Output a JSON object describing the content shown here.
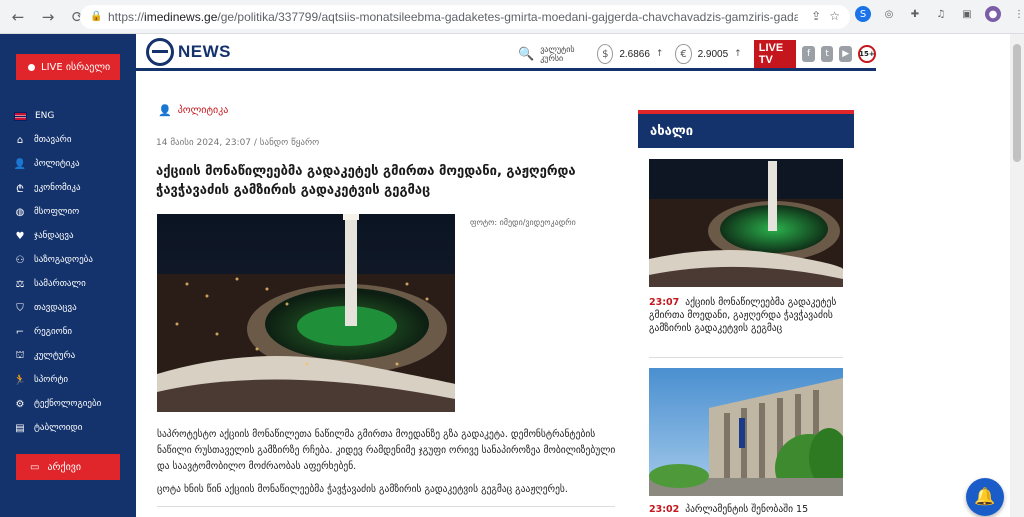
{
  "browser": {
    "url_prefix": "https://",
    "url_host": "imedinews.ge",
    "url_path": "/ge/politika/337799/aqtsiis-monatsileebma-gadaketes-gmirta-moedani-gajgerda-chavchavadzis-gamziris-gadaketvis-gegmats"
  },
  "sidebar": {
    "live_label": "LIVE ისრაელი",
    "items": [
      {
        "label": "ENG",
        "icon": "flag-uk-icon"
      },
      {
        "label": "მთავარი",
        "icon": "home-icon"
      },
      {
        "label": "პოლიტიკა",
        "icon": "person-icon"
      },
      {
        "label": "ეკონომიკა",
        "icon": "money-icon"
      },
      {
        "label": "მსოფლიო",
        "icon": "globe-icon"
      },
      {
        "label": "ჯანდაცვა",
        "icon": "heart-icon"
      },
      {
        "label": "საზოგადოება",
        "icon": "group-icon"
      },
      {
        "label": "სამართალი",
        "icon": "scales-icon"
      },
      {
        "label": "თავდაცვა",
        "icon": "shield-icon"
      },
      {
        "label": "რეგიონი",
        "icon": "region-icon"
      },
      {
        "label": "კულტურა",
        "icon": "museum-icon"
      },
      {
        "label": "სპორტი",
        "icon": "running-icon"
      },
      {
        "label": "ტექნოლოგიები",
        "icon": "tech-icon"
      },
      {
        "label": "ტაბლოიდი",
        "icon": "tabloid-icon"
      }
    ],
    "archive_label": "არქივი"
  },
  "header": {
    "logo_text": "NEWS",
    "rate_label": "ვალუტის კურსი",
    "usd_symbol": "$",
    "usd_rate": "2.6866",
    "eur_symbol": "€",
    "eur_rate": "2.9005",
    "arrow": "↑",
    "live_tv": "LIVE TV",
    "age_rating": "15+"
  },
  "article": {
    "category": "პოლიტიკა",
    "date": "14 მაისი 2024, 23:07",
    "source": "სანდო წყარო",
    "title": "აქციის მონაწილეებმა გადაკეტეს გმირთა მოედანი, გაჟღერდა ჭავჭავაძის გამზირის გადაკეტვის გეგმაც",
    "photo_credit": "ფოტო: იმედი/ვიდეოკადრი",
    "paragraph1": "საპროტესტო აქციის მონაწილეთა ნაწილმა გმირთა მოედანზე გზა გადაკეტა. დემონსტრანტების ნაწილი რუსთაველის გამზირზე რჩება. კიდევ რამდენიმე ჯგუფი ორივე სანაპიროზეა მობილიზებული და საავტომობილო მოძრაობას აფერხებენ.",
    "paragraph2": "ცოტა ხნის წინ აქციის მონაწილეებმა ჭავჭავაძის გამზირის გადაკეტვის გეგმაც გააჟღერეს."
  },
  "side": {
    "heading": "ახალი",
    "news": [
      {
        "time": "23:07",
        "title": "აქციის მონაწილეებმა გადაკეტეს გმირთა მოედანი, გაჟღერდა ჭავჭავაძის გამზირის გადაკეტვის გეგმაც"
      },
      {
        "time": "23:02",
        "title": "პარლამენტის შენობაში 15"
      }
    ]
  },
  "colors": {
    "navy": "#14336c",
    "red": "#e0262b"
  }
}
